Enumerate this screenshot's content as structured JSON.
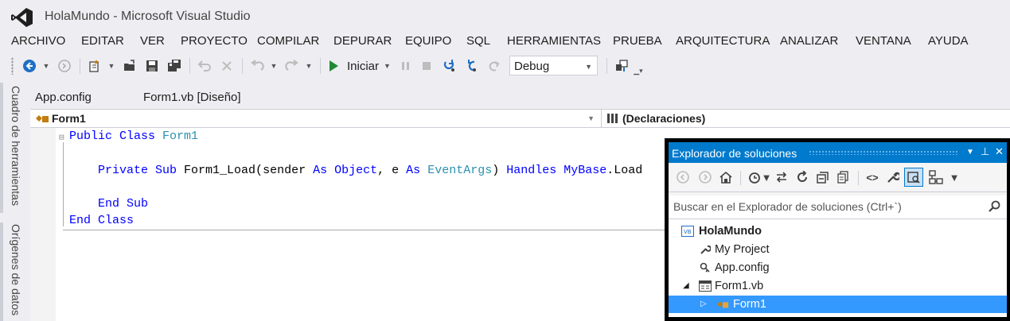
{
  "window": {
    "title": "HolaMundo - Microsoft Visual Studio"
  },
  "menu": [
    "ARCHIVO",
    "EDITAR",
    "VER",
    "PROYECTO",
    "COMPILAR",
    "DEPURAR",
    "EQUIPO",
    "SQL",
    "HERRAMIENTAS",
    "PRUEBA",
    "ARQUITECTURA",
    "ANALIZAR",
    "VENTANA",
    "AYUDA"
  ],
  "toolbar": {
    "start_label": "Iniciar",
    "configuration": "Debug"
  },
  "left_tabs": {
    "toolbox": "Cuadro de herramientas",
    "data_sources": "Orígenes de datos"
  },
  "doc_tabs": [
    "App.config",
    "Form1.vb [Diseño]"
  ],
  "navbar": {
    "class_name": "Form1",
    "member_name": "(Declaraciones)"
  },
  "code": {
    "line1_kw": "Public Class",
    "line1_type": "Form1",
    "line2_kw": "Private Sub",
    "line2_a": "Form1_Load(sender",
    "line2_as1": "As",
    "line2_obj": "Object",
    "line2_b": ", e",
    "line2_as2": "As",
    "line2_type": "EventArgs",
    "line2_c": ")",
    "line2_handles": "Handles",
    "line2_mybase": "MyBase",
    "line2_d": ".Load",
    "line3": "End Sub",
    "line4": "End Class"
  },
  "solution_explorer": {
    "title": "Explorador de soluciones",
    "search_placeholder": "Buscar en el Explorador de soluciones (Ctrl+`)",
    "tree": [
      {
        "label": "HolaMundo",
        "bold": true
      },
      {
        "label": "My Project"
      },
      {
        "label": "App.config"
      },
      {
        "label": "Form1.vb"
      },
      {
        "label": "Form1",
        "selected": true
      }
    ]
  },
  "colors": {
    "accent": "#007acc",
    "selection": "#3399ff",
    "keyword": "#0000ff",
    "type": "#2b91af",
    "start": "#1e8a32"
  }
}
